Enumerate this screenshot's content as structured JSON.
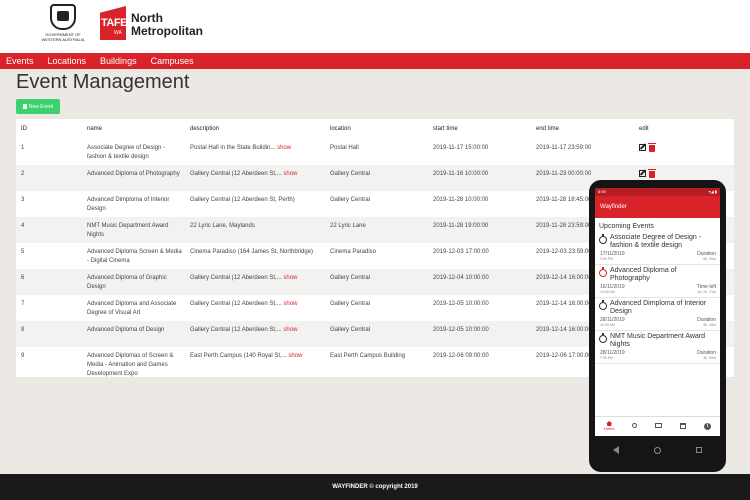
{
  "header": {
    "gov_logo_text": "GOVERNMENT OF WESTERN AUSTRALIA",
    "tafe_word": "TAFE",
    "tafe_sub": "WA",
    "brand_line1": "North",
    "brand_line2": "Metropolitan"
  },
  "nav": {
    "items": [
      {
        "label": "Events"
      },
      {
        "label": "Locations"
      },
      {
        "label": "Buildings"
      },
      {
        "label": "Campuses"
      }
    ]
  },
  "main": {
    "title": "Event Management",
    "new_button": "New Event"
  },
  "table": {
    "headers": {
      "id": "ID",
      "name": "name",
      "description": "description",
      "location": "location",
      "start": "start time",
      "end": "end time",
      "edit": "edit"
    },
    "show_label": "show",
    "rows": [
      {
        "id": "1",
        "name": "Associate Degree of Design - fashion & textile design",
        "description": "Postal Hall in the State Buildin...",
        "location": "Postal Hall",
        "start": "2019-11-17 15:00:00",
        "end": "2019-11-17 23:59:00"
      },
      {
        "id": "2",
        "name": "Advanced Diploma of Photography",
        "description": "Gallery Central (12 Aberdeen St,...",
        "location": "Gallery Central",
        "start": "2019-11-16 10:00:00",
        "end": "2019-11-23 00:00:00"
      },
      {
        "id": "3",
        "name": "Advanced Dimploma of Interior Design",
        "description": "Gallery Central (12 Aberdeen St, Perth)",
        "location": "Gallery Central",
        "start": "2019-11-28 10:00:00",
        "end": "2019-11-28 18:45:00"
      },
      {
        "id": "4",
        "name": "NMT Music Department Award Nights",
        "description": "22 Lyric Lane, Maylands",
        "location": "22 Lyric Lane",
        "start": "2019-11-28 19:00:00",
        "end": "2019-11-28 23:59:00"
      },
      {
        "id": "5",
        "name": "Advanced Diploma Screen & Media - Digital Cinema",
        "description": "Cinema Paradiso (164 James St, Northbridge)",
        "location": "Cinema Paradiso",
        "start": "2019-12-03 17:00:00",
        "end": "2019-12-03 23:59:00"
      },
      {
        "id": "6",
        "name": "Advanced Diploma of Graphic Design",
        "description": "Gallery Central (12 Aberdeen St,...",
        "location": "Gallery Central",
        "start": "2019-12-04 10:00:00",
        "end": "2019-12-14 16:00:00"
      },
      {
        "id": "7",
        "name": "Advanced Diploma and Associate Degree of Visual Art",
        "description": "Gallery Central (12 Aberdeen St,...",
        "location": "Gallery Central",
        "start": "2019-12-05 10:00:00",
        "end": "2019-12-14 16:00:00"
      },
      {
        "id": "8",
        "name": "Advanced Diploma of Design",
        "description": "Gallery Central (12 Aberdeen St,...",
        "location": "Gallery Central",
        "start": "2019-12-05 10:00:00",
        "end": "2019-12-14 16:00:00"
      },
      {
        "id": "9",
        "name": "Advanced Diplomas of Screen & Media - Animation and Games Development Expo",
        "description": "East Perth Campus (140 Royal St,...",
        "location": "East Perth Campus Building",
        "start": "2019-12-06 09:00:00",
        "end": "2019-12-06 17:00:00"
      }
    ]
  },
  "footer": {
    "text": "WAYFINDER © copyright 2019"
  },
  "phone": {
    "status_time": "8:59",
    "status_right": "▾◢ ▮",
    "app_title": "Wayfinder",
    "section_title": "Upcoming Events",
    "events": [
      {
        "name": "Associate Degree of Design - fashion & textile design",
        "date": "17/11/2019",
        "time": "3:00 PM",
        "label": "Duration",
        "value": "8h, 59m",
        "active": false
      },
      {
        "name": "Advanced Diploma of Photography",
        "date": "16/11/2019",
        "time": "10:00 AM",
        "label": "Time left",
        "value": "6d, 2h, 21m",
        "active": true
      },
      {
        "name": "Advanced Dimploma of Interior Design",
        "date": "28/11/2019",
        "time": "10:00 AM",
        "label": "Duration",
        "value": "8h, 45m",
        "active": false
      },
      {
        "name": "NMT Music Department Award Nights",
        "date": "28/11/2019",
        "time": "7:00 PM",
        "label": "Duration",
        "value": "4h, 59m",
        "active": false
      }
    ],
    "bottom_nav": {
      "home_label": "Home"
    },
    "accent": "#d9232a"
  }
}
